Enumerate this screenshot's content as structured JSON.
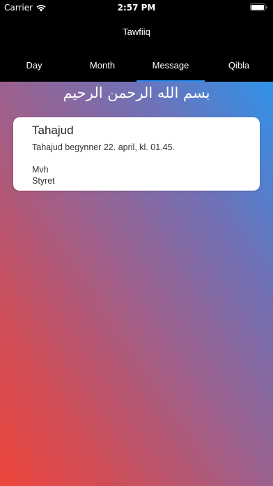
{
  "status_bar": {
    "carrier": "Carrier",
    "time": "2:57 PM",
    "wifi_icon": "wifi-icon",
    "battery_icon": "battery-icon"
  },
  "nav": {
    "title": "Tawfiiq"
  },
  "tabs": [
    {
      "label": "Day",
      "active": false
    },
    {
      "label": "Month",
      "active": false
    },
    {
      "label": "Message",
      "active": true
    },
    {
      "label": "Qibla",
      "active": false
    }
  ],
  "colors": {
    "tab_indicator": "#2f8df5",
    "gradient_top_right": "#2f92ea",
    "gradient_bottom_left": "#ee463c"
  },
  "basmala": "بسم الله الرحمن الرحيم",
  "message": {
    "title": "Tahajud",
    "text": "Tahajud begynner 22. april, kl. 01.45.",
    "sign_off": "Mvh",
    "signature": "Styret"
  }
}
